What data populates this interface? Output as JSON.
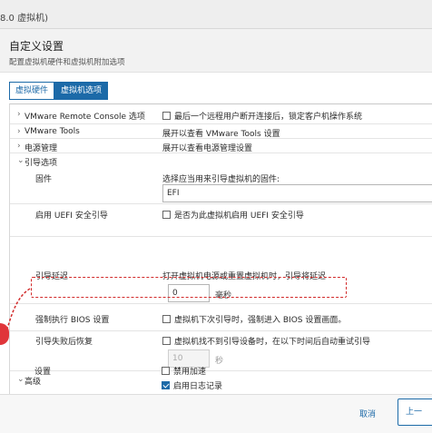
{
  "window": {
    "title": "8.0 虚拟机)"
  },
  "dialog": {
    "title": "自定义设置",
    "subtitle": "配置虚拟机硬件和虚拟机附加选项"
  },
  "tabs": [
    {
      "label": "虚拟硬件",
      "active": false
    },
    {
      "label": "虚拟机选项",
      "active": true
    }
  ],
  "settings": {
    "vmrc": {
      "label": "VMware Remote Console 选项",
      "value": "最后一个远程用户断开连接后，锁定客户机操作系统",
      "checked": false
    },
    "tools": {
      "label": "VMware Tools",
      "value": "展开以查看 VMware Tools 设置"
    },
    "power": {
      "label": "电源管理",
      "value": "展开以查看电源管理设置"
    },
    "boot": {
      "label": "引导选项",
      "firmware": {
        "label": "固件",
        "desc": "选择应当用来引导虚拟机的固件:",
        "value": "EFI"
      },
      "secure_boot": {
        "label": "启用 UEFI 安全引导",
        "value": "是否为此虚拟机启用 UEFI 安全引导",
        "checked": false
      },
      "boot_delay": {
        "label": "引导延迟",
        "desc": "打开虚拟机电源或重置虚拟机时，引导将延迟",
        "value": "0",
        "unit": "毫秒"
      },
      "force_bios": {
        "label": "强制执行 BIOS 设置",
        "value": "虚拟机下次引导时，强制进入 BIOS 设置画面。",
        "checked": false
      },
      "failed_boot": {
        "label": "引导失败后恢复",
        "value": "虚拟机找不到引导设备时，在以下时间后自动重试引导",
        "checked": false,
        "retry": "10",
        "unit": "秒"
      }
    },
    "advanced": {
      "label": "高级",
      "settings_label": "设置",
      "disable_accel": {
        "label": "禁用加速",
        "checked": false
      },
      "enable_logging": {
        "label": "启用日志记录",
        "checked": true
      }
    }
  },
  "footer": {
    "cancel": "取消",
    "prev": "上一"
  },
  "colors": {
    "accent": "#1c6aa8",
    "highlight": "#d22a2a"
  }
}
